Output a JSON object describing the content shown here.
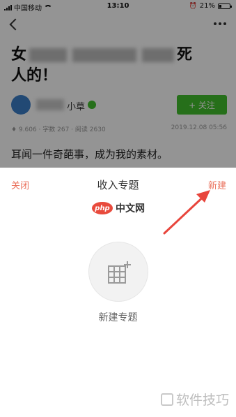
{
  "status_bar": {
    "carrier": "中国移动",
    "time": "13:10",
    "battery": "21%",
    "battery_level": 0.21
  },
  "article": {
    "title_prefix": "女",
    "title_suffix": "死",
    "title_line2": "人的！",
    "author_name_suffix": "小草",
    "follow_label": "+ 关注",
    "meta": "♦ 9.606 · 字数 267 · 阅读 2630",
    "date": "2019.12.08 05:56",
    "body_line": "耳闻一件奇葩事，成为我的素材。"
  },
  "sheet": {
    "close_label": "关闭",
    "title": "收入专题",
    "new_label": "新建",
    "new_collection_label": "新建专题"
  },
  "php_logo": {
    "badge": "php",
    "text": "中文网"
  },
  "watermark": {
    "text": "软件技巧"
  },
  "colors": {
    "accent": "#ea6f5a",
    "follow_green": "#42c02e",
    "arrow_red": "#e8453c"
  }
}
